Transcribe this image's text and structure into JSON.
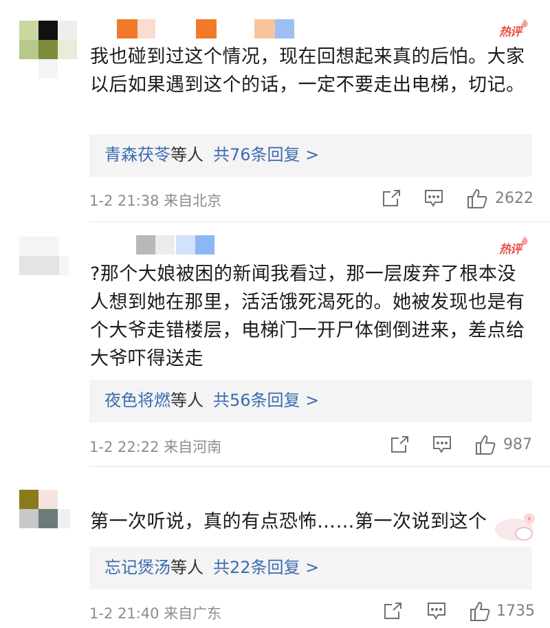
{
  "comments": [
    {
      "badge": "热评",
      "content": "我也碰到过这个情况，现在回想起来真的后怕。大家以后如果遇到这个的话，一定不要走出电梯，切记。",
      "reply": {
        "names": "青森茯苓",
        "suffix": "等人",
        "count_label": "共76条回复 >"
      },
      "time": "1-2 21:38 来自北京",
      "likes": "2622",
      "avatar_colors": [
        "#c8d8a0",
        "#111111",
        "#e8e8e8",
        "#b5c98a",
        "#7a8c3c",
        "#e0e8c8",
        "#f2f2f2",
        "#f6f6f6",
        "#ffffff"
      ],
      "name_colors": [
        "#f07a2a",
        "#f8dccc",
        "#f07a2a",
        "#f8c49a",
        "#9cc0f4"
      ]
    },
    {
      "badge": "热评",
      "content": "?那个大娘被困的新闻我看过，那一层废弃了根本没人想到她在那里，活活饿死渴死的。她被发现也是有个大爷走错楼层，电梯门一开尸体倒倒进来，差点给大爷吓得送走",
      "reply": {
        "names": "夜色将燃",
        "suffix": "等人",
        "count_label": "共56条回复 >"
      },
      "time": "1-2 22:22 来自河南",
      "likes": "987",
      "avatar_colors": [
        "#f3f3f3",
        "#f6f6f6",
        "#ffffff",
        "#dcdcdc",
        "#e2e2e2",
        "#f4f4f4",
        "#ffffff",
        "#ffffff",
        "#f8f8f8"
      ],
      "name_colors": [
        "#b8b8b8",
        "#e8e8e8",
        "#d0e0f8",
        "#8ab8f4"
      ]
    },
    {
      "badge": "",
      "content": "第一次听说，真的有点恐怖……第一次说到这个",
      "reply": {
        "names": "忘记煲汤",
        "suffix": "等人",
        "count_label": "共22条回复 >"
      },
      "time": "1-2 21:40 来自广东",
      "likes": "1735",
      "avatar_colors": [
        "#8a7a1c",
        "#f4e4e0",
        "#ffffff",
        "#c8c8c8",
        "#6c7a7a",
        "#ffffff",
        "#f0f0f0",
        "#f8f8f8",
        "#ffffff"
      ],
      "name_colors": []
    }
  ],
  "icons": {
    "share": "share-icon",
    "comment": "comment-icon",
    "like": "thumbs-up-icon"
  },
  "colors": {
    "link": "#3b6bb0",
    "hot": "#e8504a",
    "meta": "#8c8c8c",
    "reply_bg": "#f4f4f4"
  }
}
